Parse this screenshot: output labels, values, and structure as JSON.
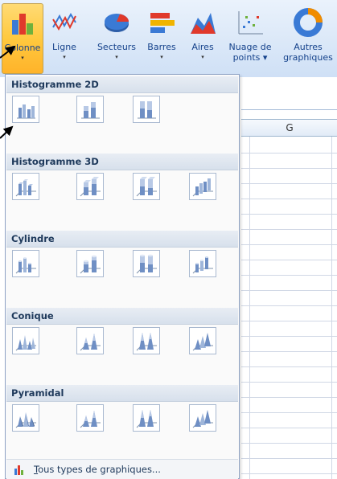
{
  "ribbon": {
    "buttons": [
      {
        "label": "Colonne",
        "icon": "column-chart-icon"
      },
      {
        "label": "Ligne",
        "icon": "line-chart-icon"
      },
      {
        "label": "Secteurs",
        "icon": "pie-chart-icon"
      },
      {
        "label": "Barres",
        "icon": "bar-chart-icon"
      },
      {
        "label": "Aires",
        "icon": "area-chart-icon"
      },
      {
        "label": "Nuage de points",
        "label_line1": "Nuage de",
        "label_line2": "points",
        "icon": "scatter-chart-icon"
      },
      {
        "label": "Autres graphiques",
        "label_line1": "Autres",
        "label_line2": "graphiques",
        "icon": "donut-chart-icon"
      }
    ],
    "dropdown_arrow": "▾"
  },
  "sheet": {
    "column_header": "G"
  },
  "menu": {
    "sections": [
      {
        "title": "Histogramme 2D"
      },
      {
        "title": "Histogramme 3D"
      },
      {
        "title": "Cylindre"
      },
      {
        "title": "Conique"
      },
      {
        "title": "Pyramidal"
      }
    ],
    "footer_label": "Tous types de graphiques...",
    "footer_mnemonic": "T",
    "footer_rest": "ous types de graphiques..."
  },
  "colors": {
    "ribbon_active": "#ffc93f",
    "section_header": "#dbe3ee",
    "menu_border": "#8fa3c5"
  }
}
